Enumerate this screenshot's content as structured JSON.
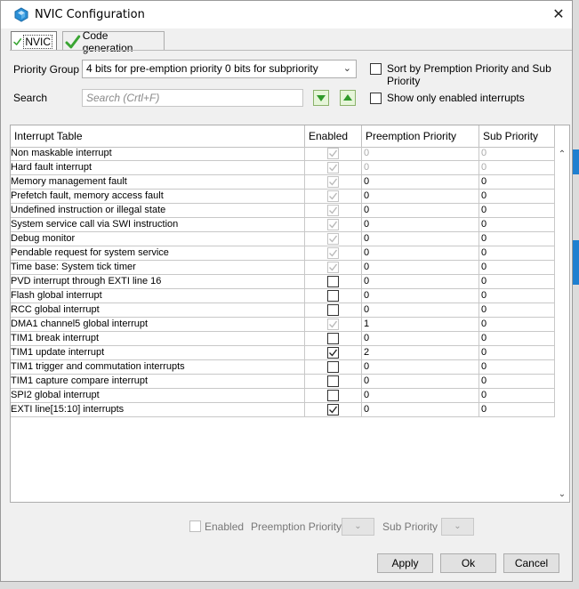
{
  "window": {
    "title": "NVIC Configuration",
    "close_glyph": "✕"
  },
  "tabs": [
    {
      "label": "NVIC",
      "active": true,
      "icon": "check-icon"
    },
    {
      "label": "Code generation",
      "active": false,
      "icon": "check-icon"
    }
  ],
  "priority_group": {
    "label": "Priority Group",
    "value": "4 bits for pre-emption priority 0 bits for subpriority"
  },
  "search": {
    "label": "Search",
    "placeholder": "Search (Crtl+F)"
  },
  "sort_option": {
    "label": "Sort by Premption Priority and Sub Priority",
    "checked": false
  },
  "show_enabled_option": {
    "label": "Show only enabled interrupts",
    "checked": false
  },
  "table": {
    "headers": [
      "Interrupt Table",
      "Enabled",
      "Preemption Priority",
      "Sub Priority"
    ],
    "rows": [
      {
        "name": "Non maskable interrupt",
        "enabled": true,
        "locked": true,
        "pre": "0",
        "sub": "0",
        "dim": true
      },
      {
        "name": "Hard fault interrupt",
        "enabled": true,
        "locked": true,
        "pre": "0",
        "sub": "0",
        "dim": true
      },
      {
        "name": "Memory management fault",
        "enabled": true,
        "locked": true,
        "pre": "0",
        "sub": "0",
        "dim": false
      },
      {
        "name": "Prefetch fault, memory access fault",
        "enabled": true,
        "locked": true,
        "pre": "0",
        "sub": "0",
        "dim": false
      },
      {
        "name": "Undefined instruction or illegal state",
        "enabled": true,
        "locked": true,
        "pre": "0",
        "sub": "0",
        "dim": false
      },
      {
        "name": "System service call via SWI instruction",
        "enabled": true,
        "locked": true,
        "pre": "0",
        "sub": "0",
        "dim": false
      },
      {
        "name": "Debug monitor",
        "enabled": true,
        "locked": true,
        "pre": "0",
        "sub": "0",
        "dim": false
      },
      {
        "name": "Pendable request for system service",
        "enabled": true,
        "locked": true,
        "pre": "0",
        "sub": "0",
        "dim": false
      },
      {
        "name": "Time base: System tick timer",
        "enabled": true,
        "locked": true,
        "pre": "0",
        "sub": "0",
        "dim": false
      },
      {
        "name": "PVD interrupt through EXTI line 16",
        "enabled": false,
        "locked": false,
        "pre": "0",
        "sub": "0",
        "dim": false
      },
      {
        "name": "Flash global interrupt",
        "enabled": false,
        "locked": false,
        "pre": "0",
        "sub": "0",
        "dim": false
      },
      {
        "name": "RCC global interrupt",
        "enabled": false,
        "locked": false,
        "pre": "0",
        "sub": "0",
        "dim": false
      },
      {
        "name": "DMA1 channel5 global interrupt",
        "enabled": true,
        "locked": true,
        "pre": "1",
        "sub": "0",
        "dim": false
      },
      {
        "name": "TIM1 break interrupt",
        "enabled": false,
        "locked": false,
        "pre": "0",
        "sub": "0",
        "dim": false
      },
      {
        "name": "TIM1 update interrupt",
        "enabled": true,
        "locked": false,
        "pre": "2",
        "sub": "0",
        "dim": false
      },
      {
        "name": "TIM1 trigger and commutation interrupts",
        "enabled": false,
        "locked": false,
        "pre": "0",
        "sub": "0",
        "dim": false
      },
      {
        "name": "TIM1 capture compare interrupt",
        "enabled": false,
        "locked": false,
        "pre": "0",
        "sub": "0",
        "dim": false
      },
      {
        "name": "SPI2 global interrupt",
        "enabled": false,
        "locked": false,
        "pre": "0",
        "sub": "0",
        "dim": false
      },
      {
        "name": "EXTI line[15:10] interrupts",
        "enabled": true,
        "locked": false,
        "pre": "0",
        "sub": "0",
        "dim": false
      }
    ]
  },
  "selection_editor": {
    "enabled_label": "Enabled",
    "preemption_label": "Preemption Priority",
    "sub_label": "Sub Priority"
  },
  "buttons": {
    "apply": "Apply",
    "ok": "Ok",
    "cancel": "Cancel"
  },
  "colors": {
    "accent_check": "#3aa533",
    "titlebar": "#ffffff",
    "dialog_bg": "#f0f0f0"
  }
}
